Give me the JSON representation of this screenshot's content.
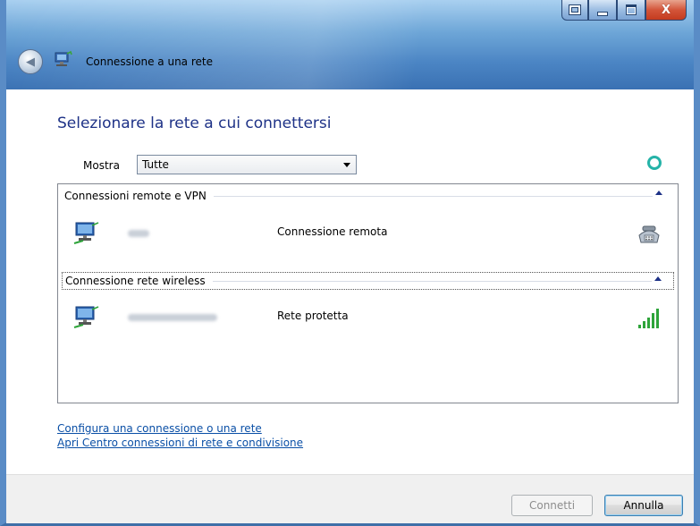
{
  "window": {
    "title": "Connessione a una rete",
    "controls": {
      "restore_icon": "window-switch-icon",
      "minimize_icon": "minimize-icon",
      "maximize_icon": "maximize-icon",
      "close_label": "X"
    }
  },
  "header": {
    "heading": "Selezionare la rete a cui connettersi",
    "filter_label": "Mostra",
    "filter_value": "Tutte"
  },
  "networks": {
    "groups": [
      {
        "title": "Connessioni remote e VPN",
        "items": [
          {
            "type": "Connessione remota",
            "icon": "dialup-modem-icon"
          }
        ]
      },
      {
        "title": "Connessione rete wireless",
        "items": [
          {
            "type": "Rete protetta",
            "icon": "signal-strength-icon",
            "signal_bars": 5
          }
        ]
      }
    ]
  },
  "links": {
    "setup": "Configura una connessione o una rete",
    "center": "Apri Centro connessioni di rete e condivisione"
  },
  "footer": {
    "connect_label": "Connetti",
    "cancel_label": "Annulla"
  },
  "colors": {
    "heading": "#1e3287",
    "link": "#0a4fa6",
    "signal": "#2ea43a",
    "refresh": "#25b3a8"
  }
}
